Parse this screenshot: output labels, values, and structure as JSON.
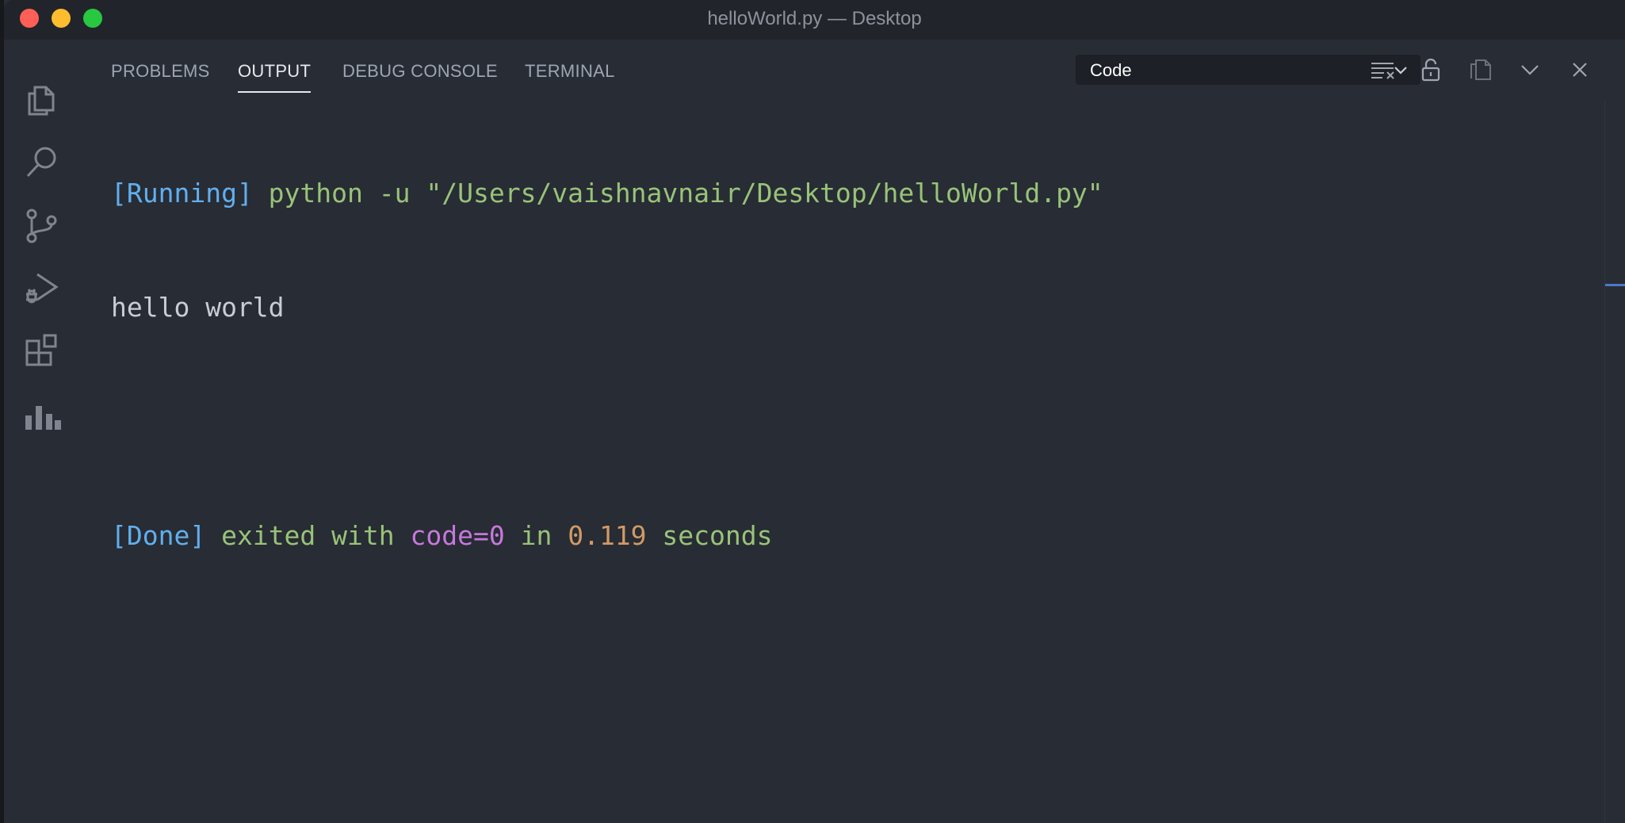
{
  "window": {
    "title": "helloWorld.py — Desktop"
  },
  "activity_bar": {
    "items": [
      {
        "name": "explorer",
        "icon": "files-icon"
      },
      {
        "name": "search",
        "icon": "search-icon"
      },
      {
        "name": "source-control",
        "icon": "source-control-icon"
      },
      {
        "name": "run-and-debug",
        "icon": "run-debug-icon"
      },
      {
        "name": "extensions",
        "icon": "extensions-icon"
      },
      {
        "name": "charts",
        "icon": "bar-chart-icon"
      }
    ]
  },
  "panel": {
    "tabs": [
      {
        "label": "PROBLEMS",
        "active": false
      },
      {
        "label": "OUTPUT",
        "active": true
      },
      {
        "label": "DEBUG CONSOLE",
        "active": false
      },
      {
        "label": "TERMINAL",
        "active": false
      }
    ],
    "channel_select": {
      "value": "Code"
    },
    "toolbar": [
      {
        "name": "clear-output",
        "icon": "clear-all-icon"
      },
      {
        "name": "lock-scroll",
        "icon": "unlock-icon"
      },
      {
        "name": "open-in-editor",
        "icon": "open-file-icon"
      },
      {
        "name": "collapse-panel",
        "icon": "chevron-down-icon"
      },
      {
        "name": "close-panel",
        "icon": "close-icon"
      }
    ]
  },
  "output": {
    "running_tag": "[Running]",
    "command": " python -u \"/Users/vaishnavnair/Desktop/helloWorld.py\"",
    "program_output": "hello world",
    "done_tag": "[Done]",
    "exited_with": " exited with ",
    "code_text": "code=0",
    "in_text": " in ",
    "duration": "0.119",
    "seconds_text": " seconds"
  },
  "colors": {
    "background": "#282c34",
    "bracket_blue": "#61afef",
    "string_green": "#98c379",
    "keyword_purple": "#c678dd",
    "number_orange": "#d19a66"
  }
}
